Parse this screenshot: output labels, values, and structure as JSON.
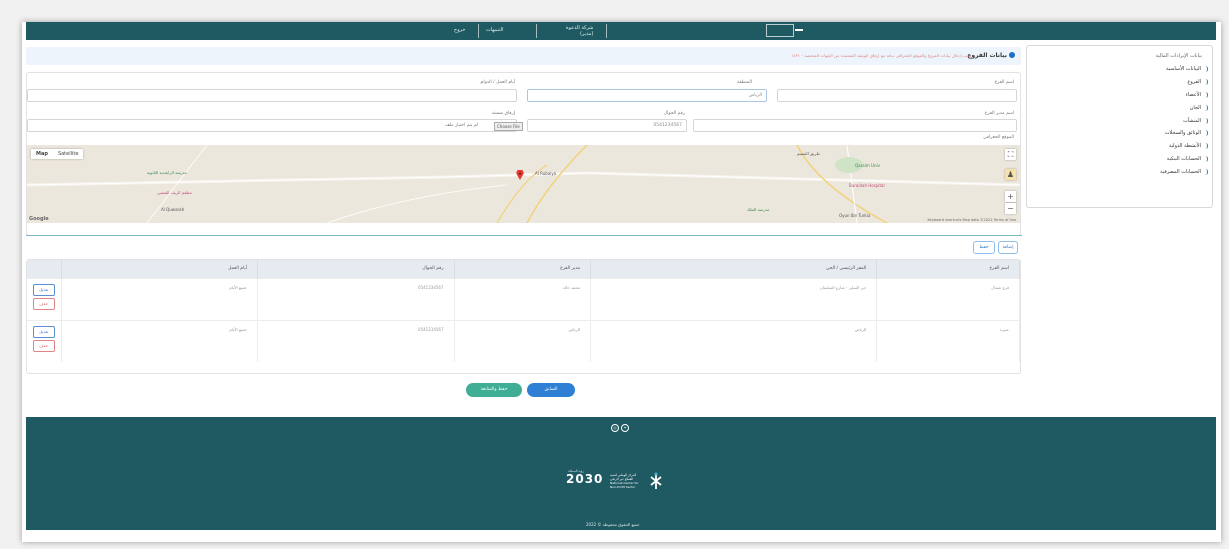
{
  "header": {
    "user_name": "شركة الدعوة",
    "user_role": "(مدير)",
    "link_alerts": "التنبيهات",
    "link_logout": "خروج"
  },
  "sidebar": {
    "title": "بيانات الإيرادات المالية",
    "items": [
      {
        "label": "البيانات الأساسية"
      },
      {
        "label": "الفروع"
      },
      {
        "label": "الأعضاء"
      },
      {
        "label": "الجان"
      },
      {
        "label": "المنشآت"
      },
      {
        "label": "الوثائق والسجلات"
      },
      {
        "label": "الأنشطة الدولية"
      },
      {
        "label": "الحسابات البنكية"
      },
      {
        "label": "الحسابات المصرفية"
      }
    ]
  },
  "notice": {
    "title": "بيانات الفروع",
    "message": "يجب إدخال بيانات الفروع والموقع الجغرافي بدقة مع إرفاق الوثيقة المعتمدة من الجهات المختصة - ١٤٣١"
  },
  "form": {
    "branch_name_label": "اسم الفرع",
    "branch_name_value": "",
    "region_label": "المنطقة",
    "region_value": "الرياض",
    "work_days_label": "أيام العمل / الدوام",
    "work_days_value": "",
    "branch_manager_label": "اسم مدير الفرع",
    "branch_manager_value": "",
    "mobile_label": "رقم الجوال",
    "mobile_value": "0541234567",
    "attachment_label": "إرفاق مستند",
    "upload_button": "Choose File",
    "upload_status": "لم يتم اختيار ملف",
    "location_label": "الموقع الجغرافي"
  },
  "map": {
    "tab_map": "Map",
    "tab_satellite": "Satellite",
    "google": "Google",
    "attribution": "Keyboard shortcuts   Map data ©2022   Terms of Use",
    "places": [
      {
        "name": "مدرسة الراشدية الثانوية"
      },
      {
        "name": "مطعم الريف الشعبي"
      },
      {
        "name": "Al Quwarah"
      },
      {
        "name": "Al Rubaiya"
      },
      {
        "name": "طريق القصيم"
      },
      {
        "name": "Buraidah Hospital"
      },
      {
        "name": "Qassim Univ"
      },
      {
        "name": "مدرسة الملك"
      },
      {
        "name": "Oyun Ibn Turkia"
      }
    ]
  },
  "actions": {
    "add_label": "إضافة",
    "save_label": "حفظ"
  },
  "table": {
    "headers": [
      "اسم الفرع",
      "المقر الرئيسي / الحي",
      "مدير الفرع",
      "رقم الجوال",
      "أيام العمل",
      ""
    ],
    "rows": [
      {
        "name": "فرع شمال",
        "address": "حي السلي - شارع السليمان",
        "manager": "محمد خالد",
        "mobile": "0541234567",
        "days": "جميع الأيام",
        "edit": "تعديل",
        "delete": "حذف"
      },
      {
        "name": "عنيزة",
        "address": "الرياض",
        "manager": "الرياض",
        "mobile": "0541234567",
        "days": "جميع الأيام",
        "edit": "تعديل",
        "delete": "حذف"
      }
    ]
  },
  "buttons": {
    "previous": "السابق",
    "save_continue": "حفظ والمتابعة"
  },
  "footer": {
    "vision_title": "2030",
    "vision_sub": "رؤية المملكة",
    "center_line1": "المركز الوطني لتنمية",
    "center_line2": "القطاع غير الربحي",
    "center_line3": "National Center for",
    "center_line4": "Non-Profit Sector",
    "copyright": "2022 © جميع الحقوق محفوظة"
  },
  "colors": {
    "brand": "#1f5a62",
    "primary_button": "#2f7fd4",
    "success_button": "#3fae95"
  }
}
